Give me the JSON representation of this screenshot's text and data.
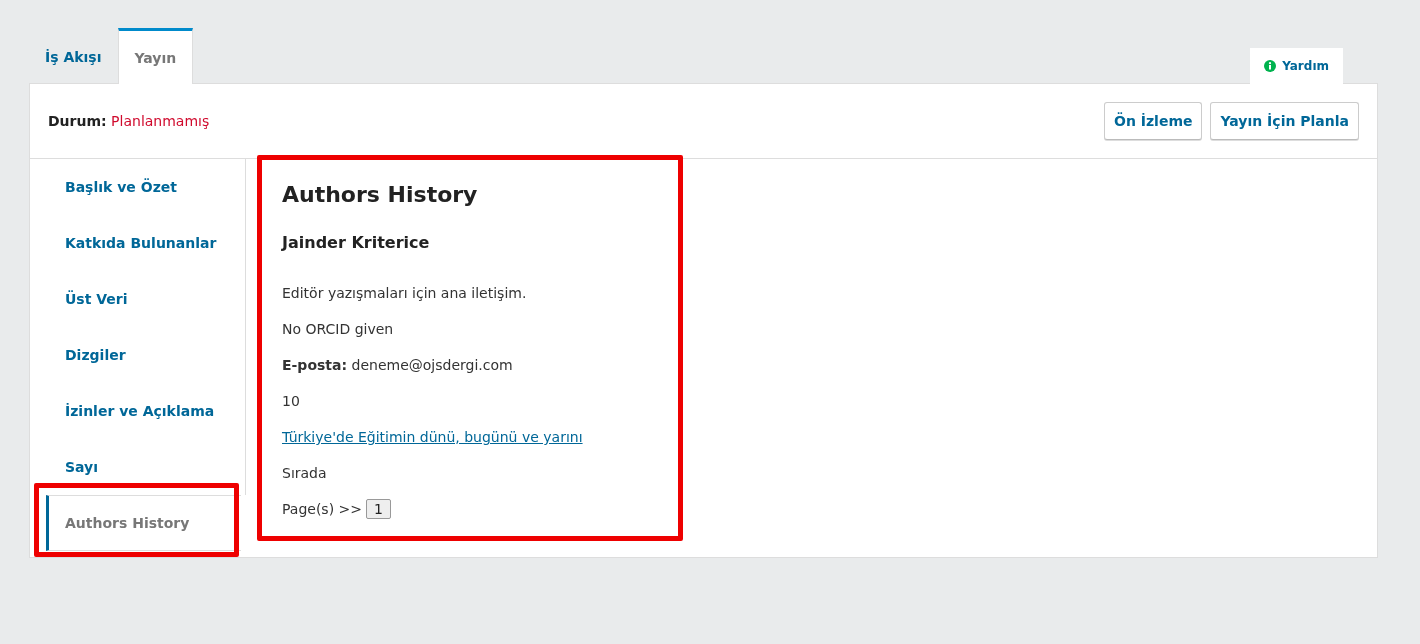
{
  "tabs": [
    {
      "label": "İş Akışı",
      "selected": false
    },
    {
      "label": "Yayın",
      "selected": true
    }
  ],
  "help": {
    "label": "Yardım"
  },
  "status": {
    "label": "Durum:",
    "value": "Planlanmamış"
  },
  "buttons": [
    "Ön İzleme",
    "Yayın İçin Planla"
  ],
  "sidebar": {
    "items": [
      {
        "label": "Başlık ve Özet",
        "selected": false
      },
      {
        "label": "Katkıda Bulunanlar",
        "selected": false
      },
      {
        "label": "Üst Veri",
        "selected": false
      },
      {
        "label": "Dizgiler",
        "selected": false
      },
      {
        "label": "İzinler ve Açıklama",
        "selected": false
      },
      {
        "label": "Sayı",
        "selected": false
      },
      {
        "label": "Authors History",
        "selected": true
      }
    ]
  },
  "content": {
    "title": "Authors History",
    "author": "Jainder Kriterice",
    "lines": [
      {
        "kind": "text",
        "text": "Editör yazışmaları için ana iletişim."
      },
      {
        "kind": "text",
        "text": "No ORCID given"
      },
      {
        "kind": "text",
        "text": "**E-posta:** deneme@ojsdergi.com"
      },
      {
        "kind": "text",
        "text": "10"
      },
      {
        "kind": "link",
        "text": "Türkiye'de Eğitimin dünü, bugünü ve yarını"
      },
      {
        "kind": "text",
        "text": "Sırada"
      },
      {
        "kind": "pages",
        "text": "Page(s) >>",
        "page": "1"
      }
    ]
  }
}
